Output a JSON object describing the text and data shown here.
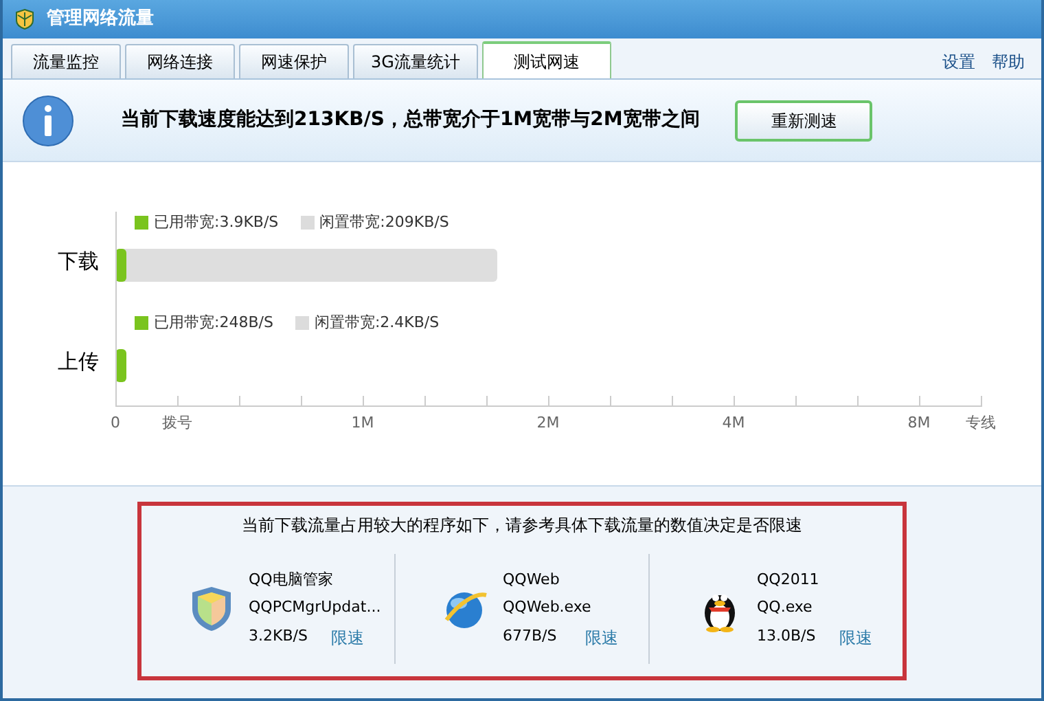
{
  "window": {
    "title": "管理网络流量"
  },
  "header_links": [
    "设置",
    "帮助"
  ],
  "tabs": [
    {
      "label": "流量监控",
      "selected": false
    },
    {
      "label": "网络连接",
      "selected": false
    },
    {
      "label": "网速保护",
      "selected": false
    },
    {
      "label": "3G流量统计",
      "selected": false
    },
    {
      "label": "测试网速",
      "selected": true
    }
  ],
  "info": {
    "message": "当前下载速度能达到213KB/S，总带宽介于1M宽带与2M宽带之间",
    "button": "重新测速"
  },
  "bandwidth": {
    "rows": [
      {
        "label": "下载",
        "used": "已用带宽:3.9KB/S",
        "idle": "闲置带宽:209KB/S",
        "level": 0.44
      },
      {
        "label": "上传",
        "used": "已用带宽:248B/S",
        "idle": "闲置带宽:2.4KB/S",
        "level": 0
      }
    ],
    "axis_labels": [
      "0",
      "拨号",
      "1M",
      "2M",
      "4M",
      "8M",
      "专线"
    ]
  },
  "programs": {
    "heading": "当前下载流量占用较大的程序如下，请参考具体下载流量的数值决定是否限速",
    "items": [
      {
        "kind": "shield",
        "name": "QQ电脑管家",
        "process": "QQPCMgrUpdat...",
        "speed": "3.2KB/S",
        "action": "限速"
      },
      {
        "kind": "globe",
        "name": "QQWeb",
        "process": "QQWeb.exe",
        "speed": "677B/S",
        "action": "限速"
      },
      {
        "kind": "penguin",
        "name": "QQ2011",
        "process": "QQ.exe",
        "speed": "13.0B/S",
        "action": "限速"
      }
    ]
  }
}
